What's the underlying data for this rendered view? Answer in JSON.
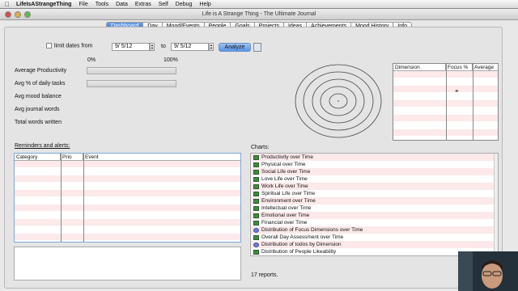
{
  "menubar": {
    "app": "LifeIsAStrangeThing",
    "items": [
      "File",
      "Tools",
      "Data",
      "Extras",
      "Self",
      "Debug",
      "Help"
    ]
  },
  "window": {
    "title": "Life is A Strange Thing - The Ultimate Journal"
  },
  "tabs": [
    "Dashboard",
    "Day",
    "Mood/Events",
    "People",
    "Goals",
    "Projects",
    "Ideas",
    "Achievements",
    "Mood History",
    "Info"
  ],
  "active_tab": "Dashboard",
  "filter": {
    "limit_label": "limit dates from",
    "from": "9/ 5/12",
    "to_label": "to",
    "to": "9/ 5/12",
    "analyze_label": "Analyze"
  },
  "stats": {
    "scale_min": "0%",
    "scale_max": "100%",
    "rows": [
      "Average Productivity",
      "Avg % of daily tasks",
      "Avg mood balance",
      "Avg journal words",
      "Total words written"
    ]
  },
  "dimension_table": {
    "columns": [
      "Dimension",
      "Focus %",
      "Average"
    ]
  },
  "reminders": {
    "title": "Reminders and alerts:",
    "columns": [
      "Category",
      "Prio",
      "Event"
    ]
  },
  "charts": {
    "title": "Charts:",
    "items": [
      {
        "label": "Productivity over Time",
        "icon": "bar-chart-icon"
      },
      {
        "label": "Physical over Time",
        "icon": "bar-chart-icon"
      },
      {
        "label": "Social Life over Time",
        "icon": "bar-chart-icon"
      },
      {
        "label": "Love Life over Time",
        "icon": "bar-chart-icon"
      },
      {
        "label": "Work Life over Time",
        "icon": "bar-chart-icon"
      },
      {
        "label": "Spiritual Life over Time",
        "icon": "bar-chart-icon"
      },
      {
        "label": "Environment over Time",
        "icon": "bar-chart-icon"
      },
      {
        "label": "Intellectual over Time",
        "icon": "bar-chart-icon"
      },
      {
        "label": "Emotional over Time",
        "icon": "bar-chart-icon"
      },
      {
        "label": "Financial over Time",
        "icon": "bar-chart-icon"
      },
      {
        "label": "Distribution of Focus Dimensions over Time",
        "icon": "pie-chart-icon"
      },
      {
        "label": "Overall Day Assessment over Time",
        "icon": "bar-chart-icon"
      },
      {
        "label": "Distribution of todos by Dimension",
        "icon": "pie-chart-icon"
      },
      {
        "label": "Distribution of People Likeability",
        "icon": "bar-chart-icon"
      }
    ],
    "count_text": "17 reports."
  }
}
